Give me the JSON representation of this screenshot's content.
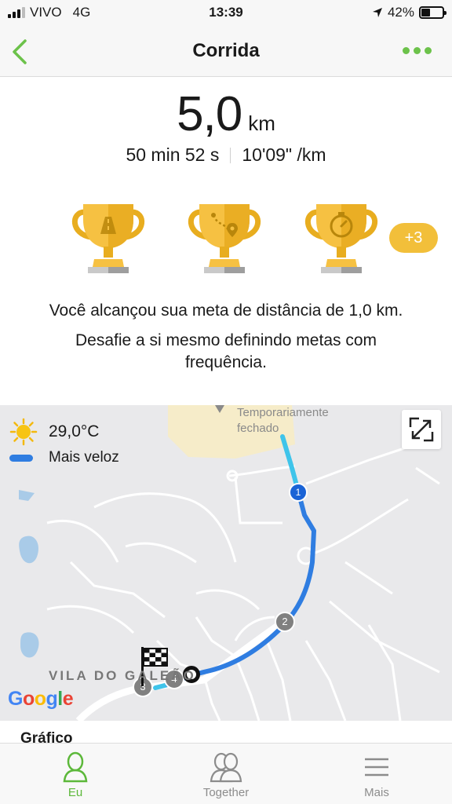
{
  "status_bar": {
    "carrier": "VIVO",
    "network": "4G",
    "time": "13:39",
    "battery": "42%",
    "battery_level": 0.42
  },
  "nav": {
    "title": "Corrida"
  },
  "summary": {
    "distance_value": "5,0",
    "distance_unit": "km",
    "duration": "50 min 52 s",
    "pace": "10'09\" /km",
    "more_badges": "+3",
    "goal_message": "Você alcançou sua meta de distância de 1,0 km.",
    "challenge_message": "Desafie a si mesmo definindo metas com frequência."
  },
  "trophies": [
    {
      "icon": "road-trophy-icon"
    },
    {
      "icon": "route-trophy-icon"
    },
    {
      "icon": "stopwatch-trophy-icon"
    }
  ],
  "map": {
    "temperature": "29,0°C",
    "legend_label": "Mais veloz",
    "poi_line1": "Temporariamente",
    "poi_line2": "fechado",
    "area_label": "VILA DO GALEÃO",
    "attribution": "Google",
    "markers": [
      "1",
      "2",
      "3",
      "4"
    ],
    "colors": {
      "fast": "#2f7de1",
      "slow": "#3fc4ea"
    }
  },
  "section": {
    "chart_heading": "Gráfico"
  },
  "tabbar": {
    "items": [
      {
        "label": "Eu"
      },
      {
        "label": "Together"
      },
      {
        "label": "Mais"
      }
    ]
  },
  "colors": {
    "accent": "#5cb83a",
    "gold": "#f2bf3a"
  }
}
